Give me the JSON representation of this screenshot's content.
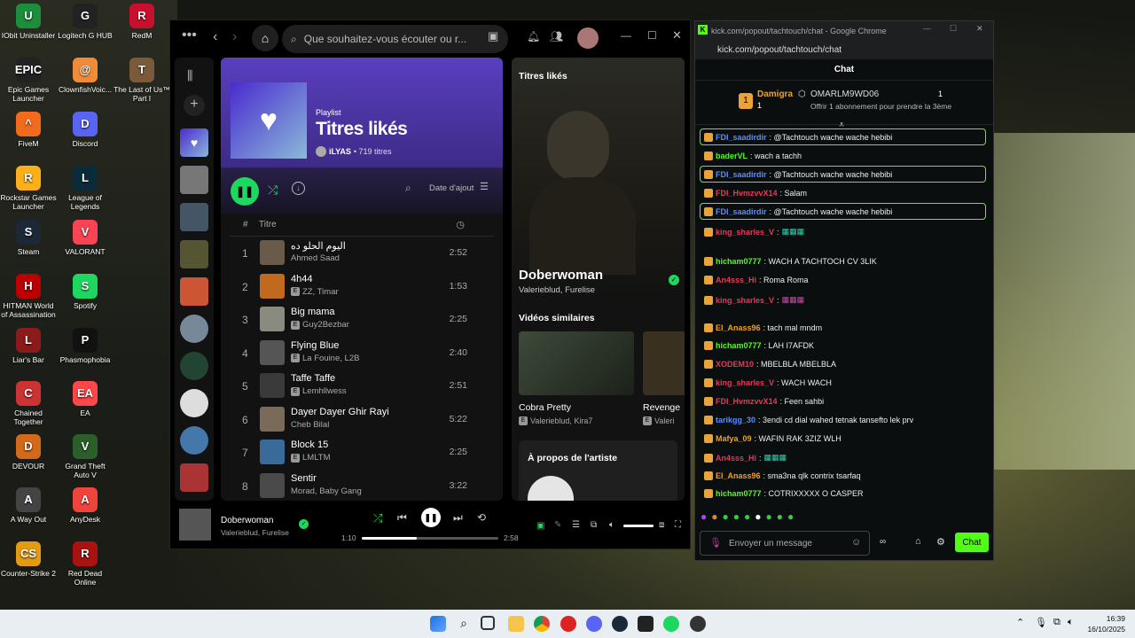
{
  "desktop": {
    "icons": [
      {
        "label": "IObit Uninstaller",
        "color": "#1b8f3b",
        "glyph": "U"
      },
      {
        "label": "Logitech G HUB",
        "color": "#222",
        "glyph": "G"
      },
      {
        "label": "RedM",
        "color": "#c8102e",
        "glyph": "R"
      },
      {
        "label": "Epic Games Launcher",
        "color": "#222",
        "glyph": "EPIC"
      },
      {
        "label": "ClownfishVoic...",
        "color": "#f08b3a",
        "glyph": "@"
      },
      {
        "label": "The Last of Us™ Part I",
        "color": "#7a5a3a",
        "glyph": "T"
      },
      {
        "label": "FiveM",
        "color": "#f26b1d",
        "glyph": "^"
      },
      {
        "label": "Discord",
        "color": "#5865f2",
        "glyph": "D"
      },
      {
        "label": "Rockstar Games Launcher",
        "color": "#fcaf17",
        "glyph": "R"
      },
      {
        "label": "League of Legends",
        "color": "#0a2b3a",
        "glyph": "L"
      },
      {
        "label": "Steam",
        "color": "#1b2838",
        "glyph": "S"
      },
      {
        "label": "VALORANT",
        "color": "#fa4454",
        "glyph": "V"
      },
      {
        "label": "HITMAN World of Assassination",
        "color": "#b00",
        "glyph": "H"
      },
      {
        "label": "Spotify",
        "color": "#1ed760",
        "glyph": "S"
      },
      {
        "label": "Liar's Bar",
        "color": "#8b1a1a",
        "glyph": "L"
      },
      {
        "label": "Phasmophobia",
        "color": "#111",
        "glyph": "P"
      },
      {
        "label": "Chained Together",
        "color": "#c33",
        "glyph": "C"
      },
      {
        "label": "EA",
        "color": "#ff4747",
        "glyph": "EA"
      },
      {
        "label": "DEVOUR",
        "color": "#d26a1a",
        "glyph": "D"
      },
      {
        "label": "Grand Theft Auto V",
        "color": "#2a5e2a",
        "glyph": "V"
      },
      {
        "label": "A Way Out",
        "color": "#444",
        "glyph": "A"
      },
      {
        "label": "AnyDesk",
        "color": "#ef443b",
        "glyph": "A"
      },
      {
        "label": "Counter-Strike 2",
        "color": "#e49b0f",
        "glyph": "CS"
      },
      {
        "label": "Red Dead Online",
        "color": "#a11",
        "glyph": "R"
      }
    ]
  },
  "spotify": {
    "search_placeholder": "Que souhaitez-vous écouter ou r...",
    "playlist_type": "Playlist",
    "playlist_title": "Titres likés",
    "owner": "iLYAS",
    "track_count": "• 719 titres",
    "sort_label": "Date d'ajout",
    "col_num": "#",
    "col_title": "Titre",
    "tracks": [
      {
        "n": "1",
        "title": "اليوم الحلو ده",
        "artist": "Ahmed Saad",
        "explicit": false,
        "dur": "2:52",
        "color": "#6a5a4a"
      },
      {
        "n": "2",
        "title": "4h44",
        "artist": "ZZ, Timar",
        "explicit": true,
        "dur": "1:53",
        "color": "#c06a20"
      },
      {
        "n": "3",
        "title": "Big mama",
        "artist": "Guy2Bezbar",
        "explicit": true,
        "dur": "2:25",
        "color": "#8a8a80"
      },
      {
        "n": "4",
        "title": "Flying Blue",
        "artist": "La Fouine, L2B",
        "explicit": true,
        "dur": "2:40",
        "color": "#555"
      },
      {
        "n": "5",
        "title": "Taffe Taffe",
        "artist": "Lemhllwess",
        "explicit": true,
        "dur": "2:51",
        "color": "#3a3a3a"
      },
      {
        "n": "6",
        "title": "Dayer Dayer Ghir Rayi",
        "artist": "Cheb Bilal",
        "explicit": false,
        "dur": "5:22",
        "color": "#7a6a5a"
      },
      {
        "n": "7",
        "title": "Block 15",
        "artist": "LMLTM",
        "explicit": true,
        "dur": "2:25",
        "color": "#3a6a9a"
      },
      {
        "n": "8",
        "title": "Sentir",
        "artist": "Morad, Baby Gang",
        "explicit": false,
        "dur": "3:22",
        "color": "#4a4a4a"
      }
    ],
    "right_title": "Titres likés",
    "now_title": "Doberwoman",
    "now_artists": "Valerieblud, Furelise",
    "similar_label": "Vidéos similaires",
    "similar": [
      {
        "title": "Cobra Pretty",
        "artist": "Valerieblud, Kira7"
      },
      {
        "title": "Revenge",
        "artist": "Valeri"
      }
    ],
    "about_label": "À propos de l'artiste",
    "player": {
      "title": "Doberwoman",
      "artists": "Valerieblud, Furelise",
      "elapsed": "1:10",
      "total": "2:58",
      "progress": 0.4
    }
  },
  "chat": {
    "window_title": "kick.com/popout/tachtouch/chat - Google Chrome",
    "url": "kick.com/popout/tachtouch/chat",
    "header": "Chat",
    "sub1_name": "Damigra",
    "sub1_count": "1",
    "sub2_name": "OMARLM9WD06",
    "sub2_count": "1",
    "sub_offer": "Offrir 1 abonnement pour prendre la 3ème",
    "messages": [
      {
        "user": "FDI_saadirdir",
        "ucolor": "#5b8cff",
        "text": ": @Tachtouch wache wache hebibi",
        "hl": true
      },
      {
        "user": "baderVL",
        "ucolor": "#53fc18",
        "text": ": wach a tachh",
        "hl": false
      },
      {
        "user": "FDI_saadirdir",
        "ucolor": "#5b8cff",
        "text": ": @Tachtouch wache wache hebibi",
        "hl": true
      },
      {
        "user": "FDI_HvmzvvX14",
        "ucolor": "#e23a5a",
        "text": ": Salam",
        "hl": false
      },
      {
        "user": "FDI_saadirdir",
        "ucolor": "#5b8cff",
        "text": ": @Tachtouch wache wache hebibi",
        "hl": true
      },
      {
        "user": "king_sharles_V",
        "ucolor": "#e23a5a",
        "text": ": ",
        "hl": false
      },
      {
        "user": "hicham0777",
        "ucolor": "#53fc18",
        "text": ": WACH A TACHTOCH CV 3LIK",
        "hl": false
      },
      {
        "user": "An4sss_Hi",
        "ucolor": "#e23a5a",
        "text": ": Roma Roma",
        "hl": false
      },
      {
        "user": "king_sharles_V",
        "ucolor": "#e23a5a",
        "text": ": ",
        "hl": false
      },
      {
        "user": "El_Anass96",
        "ucolor": "#f0a020",
        "text": ": tach mal mndm",
        "hl": false
      },
      {
        "user": "hicham0777",
        "ucolor": "#53fc18",
        "text": ": LAH I7AFDK",
        "hl": false
      },
      {
        "user": "XODEM10",
        "ucolor": "#e23a5a",
        "text": ": MBELBLA MBELBLA",
        "hl": false
      },
      {
        "user": "king_sharles_V",
        "ucolor": "#e23a5a",
        "text": ": WACH WACH",
        "hl": false
      },
      {
        "user": "FDI_HvmzvvX14",
        "ucolor": "#e23a5a",
        "text": ": Feen sahbi",
        "hl": false
      },
      {
        "user": "tarikgg_30",
        "ucolor": "#5b8cff",
        "text": ": 3endi cd dial wahed tetnak tansefto lek prv",
        "hl": false
      },
      {
        "user": "Mafya_09",
        "ucolor": "#f0a020",
        "text": ": WAFIN RAK 3ZIZ WLH",
        "hl": false
      },
      {
        "user": "An4sss_Hi",
        "ucolor": "#e23a5a",
        "text": ": ",
        "hl": false
      },
      {
        "user": "El_Anass96",
        "ucolor": "#f0a020",
        "text": ": sma3na qlk contrix tsarfaq",
        "hl": false
      },
      {
        "user": "hicham0777",
        "ucolor": "#53fc18",
        "text": ": COTRIXXXXX O CASPER",
        "hl": false
      }
    ],
    "input_placeholder": "Envoyer un message",
    "send_label": "Chat"
  },
  "taskbar": {
    "time": "16:39",
    "date": "16/10/2025"
  }
}
